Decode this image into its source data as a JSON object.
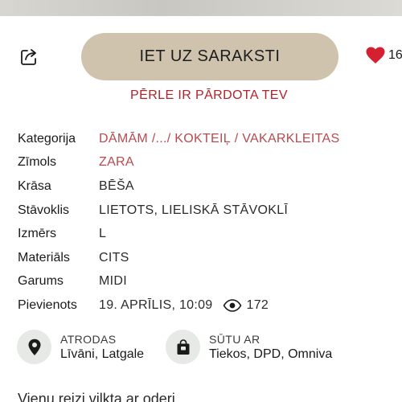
{
  "actions": {
    "primary_label": "IET UZ SARAKSTI",
    "favorite_count": "16"
  },
  "sold_note": "PĒRLE IR PĀRDOTA TEV",
  "details": {
    "category_label": "Kategorija",
    "category_crumb_1": "DĀMĀM",
    "category_crumb_2": "/.../",
    "category_crumb_3": "KOKTEIĻ / VAKARKLEITAS",
    "brand_label": "Zīmols",
    "brand_value": "ZARA",
    "color_label": "Krāsa",
    "color_value": "BĒŠA",
    "condition_label": "Stāvoklis",
    "condition_value": "LIETOTS, LIELISKĀ STĀVOKLĪ",
    "size_label": "Izmērs",
    "size_value": "L",
    "material_label": "Materiāls",
    "material_value": "CITS",
    "length_label": "Garums",
    "length_value": "MIDI",
    "added_label": "Pievienots",
    "added_value": "19. APRĪLIS, 10:09",
    "views_count": "172"
  },
  "location": {
    "caption": "ATRODAS",
    "value": "Līvāni, Latgale"
  },
  "shipping": {
    "caption": "SŪTU AR",
    "value": "Tiekos, DPD, Omniva"
  },
  "description": "Vienu reizi vilkta ar oderi",
  "colors": {
    "primary_button_bg": "#cfc3ad",
    "sold_text": "#b0232a",
    "link_text": "#b84a4f",
    "heart": "#d42030",
    "badge_bg": "#e6e9e6"
  },
  "icons": {
    "share": "share-icon",
    "heart": "heart-icon",
    "eye": "eye-icon",
    "location": "location-pin-icon",
    "shipping": "shopping-bag-icon"
  }
}
